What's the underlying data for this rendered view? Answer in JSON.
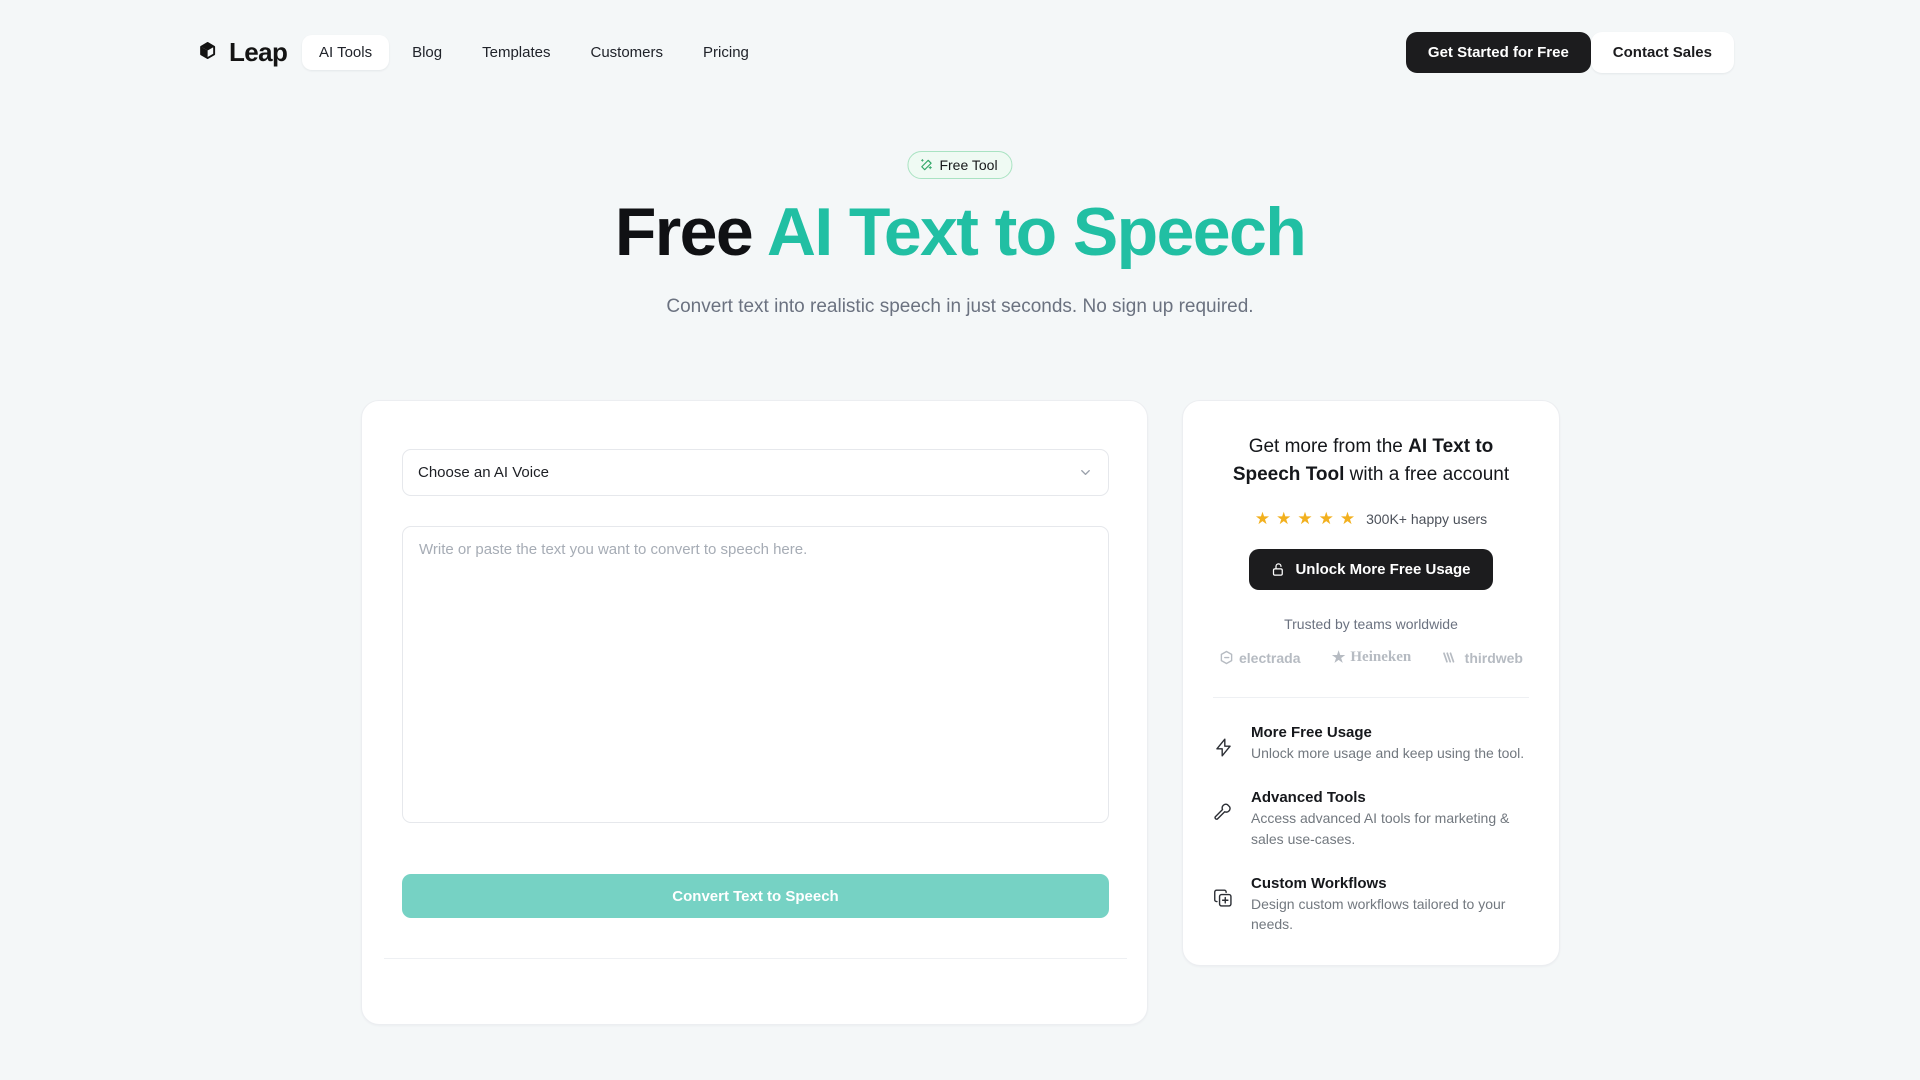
{
  "brand": {
    "name": "Leap",
    "logo_icon": "leap-cube-icon"
  },
  "nav": {
    "items": [
      {
        "label": "AI Tools",
        "active": true
      },
      {
        "label": "Blog",
        "active": false
      },
      {
        "label": "Templates",
        "active": false
      },
      {
        "label": "Customers",
        "active": false
      },
      {
        "label": "Pricing",
        "active": false
      }
    ]
  },
  "header_actions": {
    "primary_label": "Get Started for Free",
    "secondary_label": "Contact Sales"
  },
  "hero": {
    "badge_label": "Free Tool",
    "badge_icon": "magic-wand-icon",
    "title_plain": "Free ",
    "title_accent": "AI Text to Speech",
    "subtitle": "Convert text into realistic speech in just seconds. No sign up required."
  },
  "tool": {
    "voice_select_value": "Choose an AI Voice",
    "voice_select_icon": "chevron-down-icon",
    "textarea_placeholder": "Write or paste the text you want to convert to speech here.",
    "textarea_value": "",
    "convert_button_label": "Convert Text to Speech"
  },
  "side_panel": {
    "title_prefix": "Get more from the ",
    "title_bold": "AI Text to Speech Tool",
    "title_suffix": " with a free account",
    "stars": 5,
    "rating_text": "300K+ happy users",
    "unlock_button_label": "Unlock More Free Usage",
    "unlock_button_icon": "unlock-icon",
    "trusted_label": "Trusted by teams worldwide",
    "logos": [
      {
        "name": "electrada",
        "icon": "electrada-hex-icon"
      },
      {
        "name": "Heineken",
        "icon": "star-icon"
      },
      {
        "name": "thirdweb",
        "icon": "thirdweb-w-icon"
      }
    ],
    "features": [
      {
        "icon": "lightning-bolt-icon",
        "title": "More Free Usage",
        "desc": "Unlock more usage and keep using the tool."
      },
      {
        "icon": "wrench-icon",
        "title": "Advanced Tools",
        "desc": "Access advanced AI tools for marketing & sales use-cases."
      },
      {
        "icon": "copy-plus-icon",
        "title": "Custom Workflows",
        "desc": "Design custom workflows tailored to your needs."
      }
    ]
  },
  "colors": {
    "accent_teal": "#21bfa3",
    "button_teal": "#76d2c4",
    "dark": "#1c1c1e",
    "star_gold": "#f2b01e",
    "page_bg": "#f4f7f8"
  }
}
